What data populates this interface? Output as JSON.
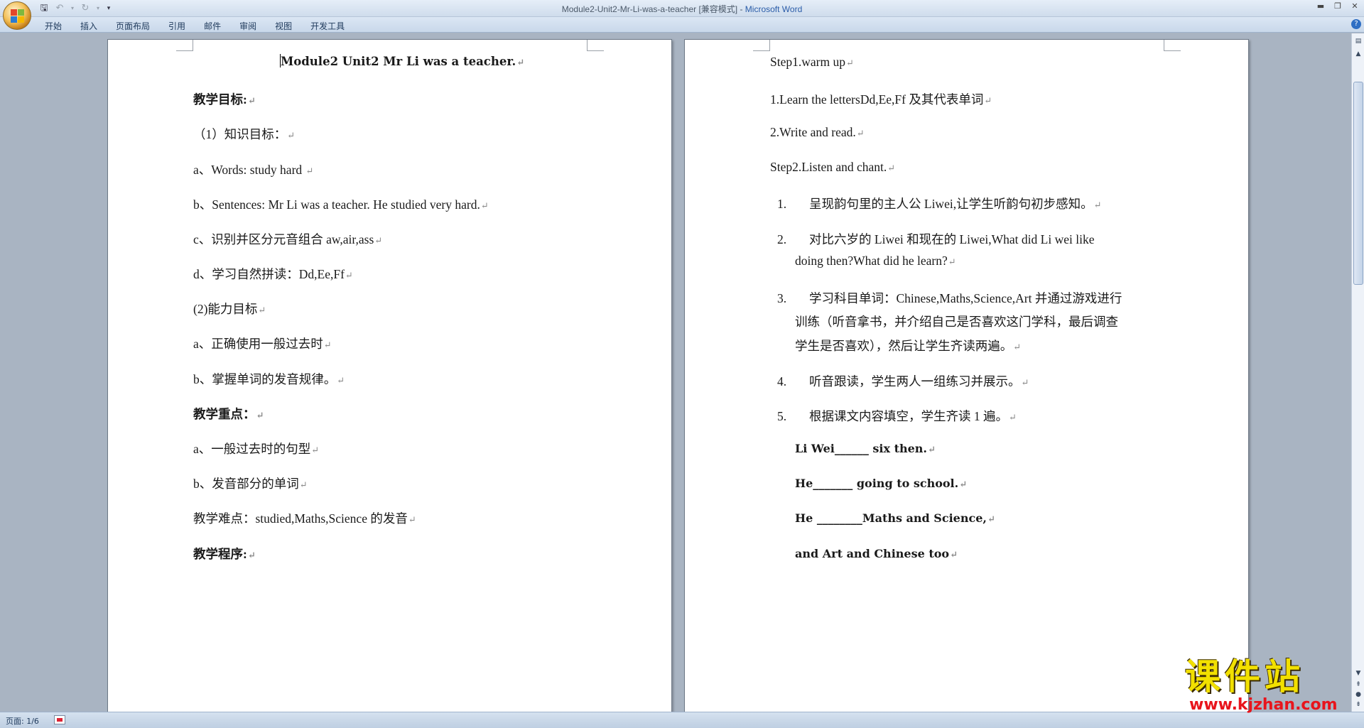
{
  "window": {
    "title_doc": "Module2-Unit2-Mr-Li-was-a-teacher [兼容模式] - ",
    "title_app": "Microsoft Word"
  },
  "ribbon": {
    "tabs": [
      "开始",
      "插入",
      "页面布局",
      "引用",
      "邮件",
      "审阅",
      "视图",
      "开发工具"
    ]
  },
  "page_left": {
    "title": "Module2 Unit2 Mr Li was a teacher.",
    "lines": [
      "教学目标:",
      "（1）知识目标：",
      "a、Words: study  hard ",
      "b、Sentences: Mr Li was a teacher. He studied very hard.",
      "c、识别并区分元音组合 aw,air,ass",
      "d、学习自然拼读：Dd,Ee,Ff",
      "(2)能力目标",
      "a、正确使用一般过去时",
      "b、掌握单词的发音规律。",
      "教学重点：",
      "a、一般过去时的句型",
      "b、发音部分的单词",
      "教学难点：studied,Maths,Science 的发音",
      "教学程序:"
    ]
  },
  "page_right": {
    "lines": [
      "Step1.warm up",
      "1.Learn the lettersDd,Ee,Ff 及其代表单词",
      "2.Write and read.",
      "Step2.Listen and chant."
    ],
    "list": [
      {
        "num": "1.",
        "text": [
          "呈现韵句里的主人公 Liwei,让学生听韵句初步感知。"
        ]
      },
      {
        "num": "2.",
        "text": [
          "对比六岁的 Liwei 和现在的 Liwei,What did Li wei like",
          "doing then?What did he learn?"
        ]
      },
      {
        "num": "3.",
        "text": [
          "学习科目单词：Chinese,Maths,Science,Art 并通过游戏进行",
          "训练（听音拿书，并介绍自己是否喜欢这门学科，最后调查",
          "学生是否喜欢），然后让学生齐读两遍。"
        ]
      },
      {
        "num": "4.",
        "text": [
          "听音跟读，学生两人一组练习并展示。"
        ]
      },
      {
        "num": "5.",
        "text": [
          "根据课文内容填空，学生齐读 1 遍。"
        ]
      }
    ],
    "blanks": [
      "Li Wei______  six then.",
      "He_______  going to school.",
      "He  ________Maths and Science,",
      "and Art and Chinese too"
    ]
  },
  "statusbar": {
    "page_info": "页面: 1/6"
  },
  "watermark": {
    "text_cn": "课件站",
    "url": "www.kjzhan.com"
  }
}
